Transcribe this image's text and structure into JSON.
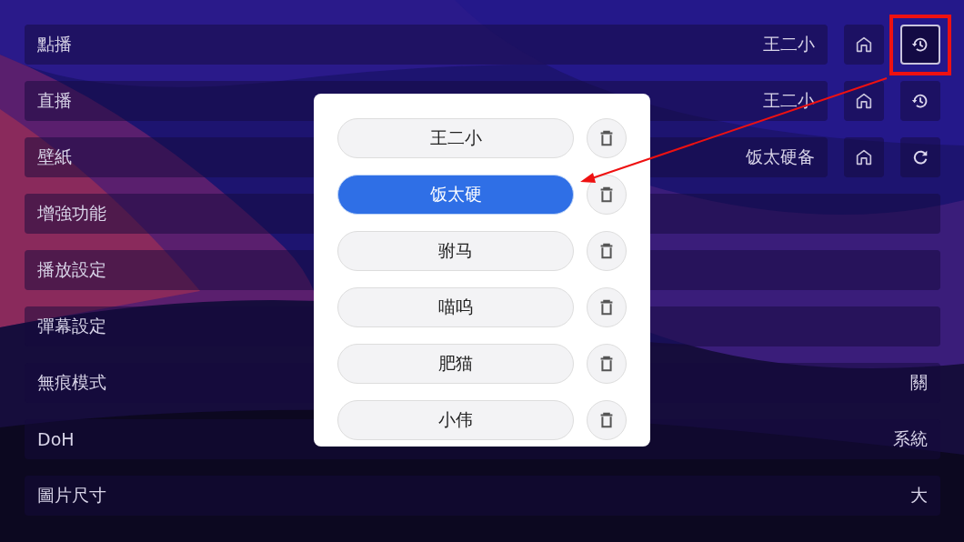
{
  "settings": [
    {
      "label": "點播",
      "kind": "source",
      "value": "王二小",
      "buttons": [
        {
          "kind": "home",
          "highlighted": false
        },
        {
          "kind": "history",
          "highlighted": true
        }
      ]
    },
    {
      "label": "直播",
      "kind": "source",
      "value": "王二小",
      "buttons": [
        {
          "kind": "home",
          "highlighted": false
        },
        {
          "kind": "history",
          "highlighted": false
        }
      ]
    },
    {
      "label": "壁紙",
      "kind": "source",
      "value": "饭太硬备",
      "buttons": [
        {
          "kind": "home",
          "highlighted": false
        },
        {
          "kind": "refresh",
          "highlighted": false
        }
      ]
    },
    {
      "label": "增強功能",
      "kind": "plain"
    },
    {
      "label": "播放設定",
      "kind": "plain"
    },
    {
      "label": "彈幕設定",
      "kind": "plain"
    },
    {
      "label": "無痕模式",
      "kind": "value",
      "value": "關"
    },
    {
      "label": "DoH",
      "kind": "value",
      "value": "系統"
    },
    {
      "label": "圖片尺寸",
      "kind": "value",
      "value": "大"
    }
  ],
  "history_dialog": {
    "items": [
      {
        "name": "王二小",
        "selected": false
      },
      {
        "name": "饭太硬",
        "selected": true
      },
      {
        "name": "驸马",
        "selected": false
      },
      {
        "name": "喵呜",
        "selected": false
      },
      {
        "name": "肥猫",
        "selected": false
      },
      {
        "name": "小伟",
        "selected": false
      }
    ]
  }
}
